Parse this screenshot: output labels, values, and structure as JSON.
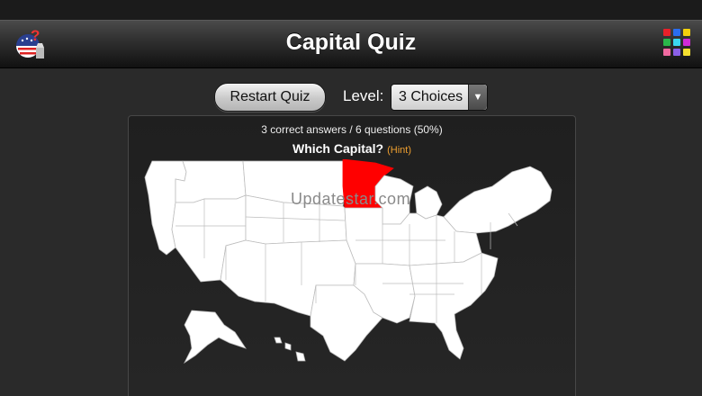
{
  "app": {
    "title": "Capital Quiz"
  },
  "controls": {
    "restart_label": "Restart Quiz",
    "level_label": "Level:",
    "level_value": "3 Choices"
  },
  "quiz": {
    "score_text": "3 correct answers / 6 questions (50%)",
    "question_text": "Which Capital?",
    "hint_text": "(Hint)",
    "watermark": "Updatestar.com"
  },
  "map": {
    "highlighted_state": "Minnesota",
    "highlight_color": "#ff0000",
    "state_fill": "#ffffff"
  },
  "icons": {
    "app_icon": "us-flag-question-icon",
    "menu_icon": "color-grid-icon",
    "grid_colors": [
      "#e8202a",
      "#2a6ef0",
      "#f5d20c",
      "#2ab64a",
      "#3ad8f0",
      "#d02ad8",
      "#f06aa0",
      "#8a60e8",
      "#f5e030"
    ]
  }
}
